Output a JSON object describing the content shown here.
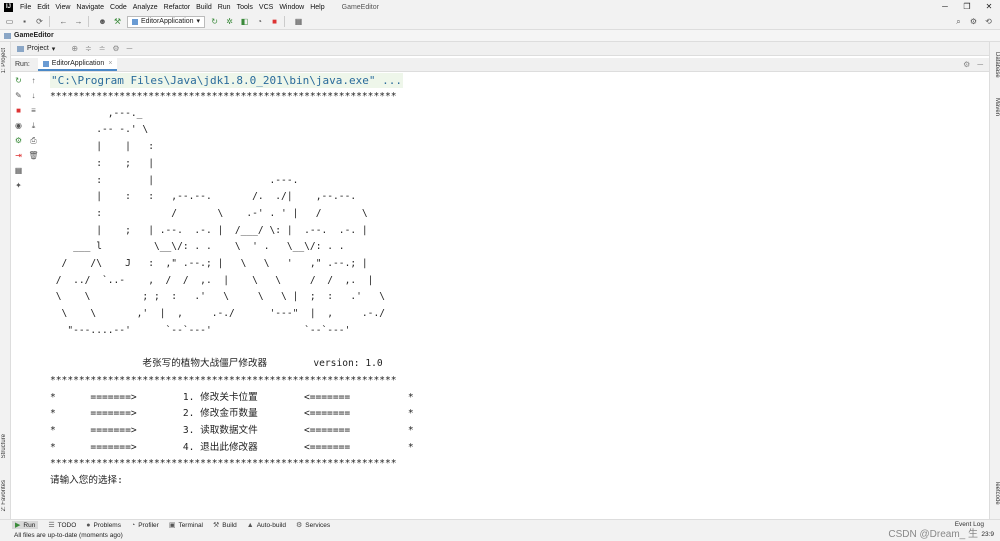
{
  "menubar": {
    "items": [
      "File",
      "Edit",
      "View",
      "Navigate",
      "Code",
      "Analyze",
      "Refactor",
      "Build",
      "Run",
      "Tools",
      "VCS",
      "Window",
      "Help"
    ],
    "window_title": "GameEditor"
  },
  "toolbar": {
    "run_config": "EditorApplication"
  },
  "navbar": {
    "project": "GameEditor"
  },
  "project_panel": {
    "label": "Project"
  },
  "run_panel": {
    "label": "Run:",
    "tab": "EditorApplication"
  },
  "console": {
    "command": "\"C:\\Program Files\\Java\\jdk1.8.0_201\\bin\\java.exe\" ...",
    "stars": "************************************************************",
    "ascii_art": [
      "          ,---._",
      "        .-- -.' \\",
      "        |    |   :",
      "        :    ;   |",
      "        :        |                    .---.",
      "        |    :   :   ,--.--.       /.  ./|    ,--.--.",
      "        :            /       \\    .-' . ' |   /       \\",
      "        |    ;   | .--.  .-. |  /___/ \\: |  .--.  .-. |",
      "    ___ l         \\__\\/: . .    \\  ' .   \\__\\/: . .",
      "  /    /\\    J   :  ,\" .--.; |   \\   \\   '   ,\" .--.; |",
      " /  ../  `..-    ,  /  /  ,.  |    \\   \\     /  /  ,.  |",
      " \\    \\         ; ;  :   .'   \\     \\   \\ |  ;  :   .'   \\",
      "  \\    \\       ,'  |  ,     .-./      '---\"  |  ,     .-./",
      "   \"---....--'      `--`---'                `--`---'"
    ],
    "banner_title": "老张写的植物大战僵尸修改器",
    "banner_version": "version: 1.0",
    "menu_lines": [
      "*      =======>        1. 修改关卡位置        <=======          *",
      "*      =======>        2. 修改金币数量        <=======          *",
      "*      =======>        3. 读取数据文件        <=======          *",
      "*      =======>        4. 退出此修改器        <=======          *"
    ],
    "prompt": "请输入您的选择:"
  },
  "left_strip": {
    "top": "1: Project",
    "structure": "Structure",
    "favorites": "2: Favorites"
  },
  "right_strip": {
    "database": "Database",
    "maven": "Maven",
    "leetcode": "leetcode"
  },
  "bottom_tools": {
    "items": [
      {
        "label": "Run",
        "icon": "▶"
      },
      {
        "label": "TODO",
        "icon": "☰"
      },
      {
        "label": "Problems",
        "icon": "●"
      },
      {
        "label": "Profiler",
        "icon": "◔"
      },
      {
        "label": "Terminal",
        "icon": "▣"
      },
      {
        "label": "Build",
        "icon": "⚒"
      },
      {
        "label": "Auto-build",
        "icon": "▲"
      },
      {
        "label": "Services",
        "icon": "⚙"
      }
    ],
    "event_log": "Event Log"
  },
  "status": {
    "message": "All files are up-to-date (moments ago)",
    "position": "23:9"
  },
  "watermark": "CSDN @Dream_ 生"
}
